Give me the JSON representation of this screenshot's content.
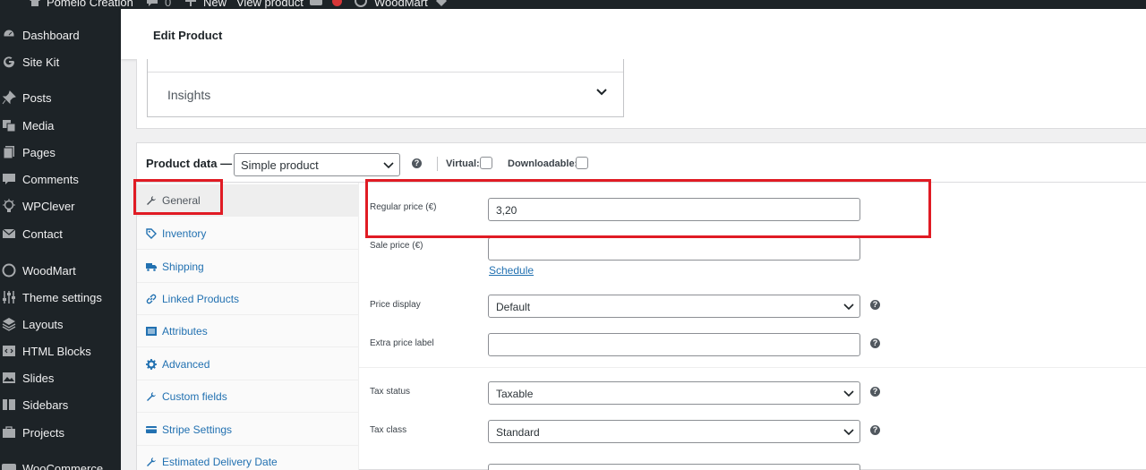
{
  "adminbar": {
    "site_name": "Pomelo Creation",
    "comments_count": "0",
    "new_label": "New",
    "view_label": "View product",
    "woodmart_label": "WoodMart"
  },
  "sidebar": {
    "items": [
      {
        "label": "Dashboard",
        "icon": "dashboard-icon"
      },
      {
        "label": "Site Kit",
        "icon": "google-g-icon"
      },
      {
        "label": "Posts",
        "icon": "pin-icon"
      },
      {
        "label": "Media",
        "icon": "media-icon"
      },
      {
        "label": "Pages",
        "icon": "pages-icon"
      },
      {
        "label": "Comments",
        "icon": "comment-icon"
      },
      {
        "label": "WPClever",
        "icon": "bulb-icon"
      },
      {
        "label": "Contact",
        "icon": "mail-icon"
      },
      {
        "label": "WoodMart",
        "icon": "woodmart-icon"
      },
      {
        "label": "Theme settings",
        "icon": "sliders-icon"
      },
      {
        "label": "Layouts",
        "icon": "layers-icon"
      },
      {
        "label": "HTML Blocks",
        "icon": "code-icon"
      },
      {
        "label": "Slides",
        "icon": "slides-icon"
      },
      {
        "label": "Sidebars",
        "icon": "sidebars-icon"
      },
      {
        "label": "Projects",
        "icon": "projects-icon"
      },
      {
        "label": "WooCommerce",
        "icon": "woo-icon"
      }
    ]
  },
  "header": {
    "title": "Edit Product"
  },
  "insights": {
    "label": "Insights"
  },
  "product_data": {
    "title": "Product data —",
    "type_value": "Simple product",
    "virtual_label": "Virtual:",
    "downloadable_label": "Downloadable:"
  },
  "tabs": [
    {
      "label": "General",
      "icon": "wrench-icon",
      "active": true
    },
    {
      "label": "Inventory",
      "icon": "tag-icon"
    },
    {
      "label": "Shipping",
      "icon": "truck-icon"
    },
    {
      "label": "Linked Products",
      "icon": "link-icon"
    },
    {
      "label": "Attributes",
      "icon": "list-icon"
    },
    {
      "label": "Advanced",
      "icon": "gear-icon"
    },
    {
      "label": "Custom fields",
      "icon": "wrench-icon"
    },
    {
      "label": "Stripe Settings",
      "icon": "card-icon"
    },
    {
      "label": "Estimated Delivery Date",
      "icon": "wrench-icon"
    }
  ],
  "fields": {
    "regular_price_label": "Regular price (€)",
    "regular_price_value": "3,20",
    "sale_price_label": "Sale price (€)",
    "sale_price_value": "",
    "schedule_link": "Schedule",
    "price_display_label": "Price display",
    "price_display_value": "Default",
    "extra_price_label": "Extra price label",
    "extra_price_value": "",
    "tax_status_label": "Tax status",
    "tax_status_value": "Taxable",
    "tax_class_label": "Tax class",
    "tax_class_value": "Standard"
  },
  "colors": {
    "sidebar_bg": "#1d2327",
    "link_blue": "#2271b1",
    "annotation_red": "#e01b24"
  }
}
